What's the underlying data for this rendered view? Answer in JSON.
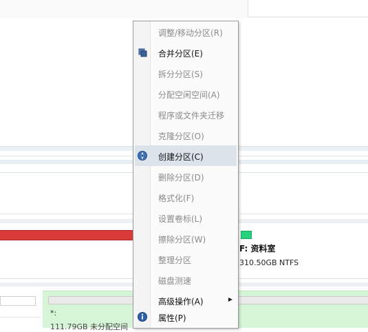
{
  "colors": {
    "selected_row": "#dde3ea",
    "used_space_bar": "#d93a3a",
    "free_space_chip": "#27d07c",
    "unallocated_region": "#d6f5d6"
  },
  "volume": {
    "name": "F: 资料室",
    "size": "310.50GB NTFS"
  },
  "unallocated": {
    "label": "*:",
    "size": "111.79GB 未分配空间"
  },
  "context_menu": {
    "items": [
      {
        "label": "调整/移动分区(R)",
        "enabled": false,
        "icon": ""
      },
      {
        "label": "合并分区(E)",
        "enabled": true,
        "icon": "merge-icon"
      },
      {
        "label": "拆分分区(S)",
        "enabled": false,
        "icon": ""
      },
      {
        "label": "分配空闲空间(A)",
        "enabled": false,
        "icon": ""
      },
      {
        "label": "程序或文件夹迁移",
        "enabled": false,
        "icon": ""
      },
      {
        "label": "克隆分区(O)",
        "enabled": false,
        "icon": ""
      },
      {
        "label": "创建分区(C)",
        "enabled": true,
        "icon": "create-partition-icon",
        "highlighted": true
      },
      {
        "label": "删除分区(D)",
        "enabled": false,
        "icon": ""
      },
      {
        "label": "格式化(F)",
        "enabled": false,
        "icon": ""
      },
      {
        "label": "设置卷标(L)",
        "enabled": false,
        "icon": ""
      },
      {
        "label": "擦除分区(W)",
        "enabled": false,
        "icon": ""
      },
      {
        "label": "整理分区",
        "enabled": false,
        "icon": ""
      },
      {
        "label": "磁盘测速",
        "enabled": false,
        "icon": ""
      },
      {
        "label": "高级操作(A)",
        "enabled": true,
        "icon": "",
        "submenu": true
      },
      {
        "label": "属性(P)",
        "enabled": true,
        "icon": "info-icon"
      }
    ]
  }
}
